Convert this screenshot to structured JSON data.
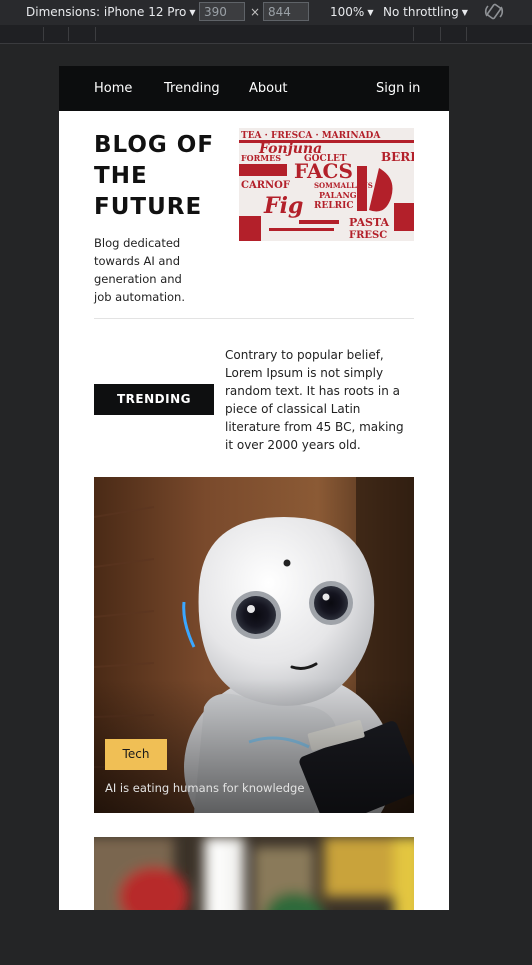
{
  "devtools": {
    "dimensions_label": "Dimensions: iPhone 12 Pro",
    "width_value": "390",
    "times_symbol": "×",
    "height_value": "844",
    "zoom_label": "100%",
    "throttle_label": "No throttling",
    "rotate_icon": "rotate-icon"
  },
  "nav": {
    "home": "Home",
    "trending": "Trending",
    "about": "About",
    "signin": "Sign in"
  },
  "hero": {
    "title": "BLOG OF THE FUTURE",
    "description": "Blog dedicated towards AI and generation and job automation.",
    "image_words": [
      "Fonjuna",
      "FORMES",
      "GOCLET",
      "BERIC",
      "FACS",
      "SOMMALLANS",
      "PALANGS",
      "RELRIC",
      "PASTA",
      "FRESC"
    ]
  },
  "trending": {
    "button_label": "TRENDING",
    "text": "Contrary to popular belief, Lorem Ipsum is not simply random text. It has roots in a piece of classical Latin literature from 45 BC, making it over 2000 years old."
  },
  "card": {
    "tag": "Tech",
    "caption": "AI is eating humans for knowledge"
  },
  "colors": {
    "nav_bg": "#0c0d0e",
    "accent_tag": "#f0bf55",
    "devtools_bg": "#292a2d",
    "page_bg": "#242526",
    "poster_red": "#b3202a"
  }
}
